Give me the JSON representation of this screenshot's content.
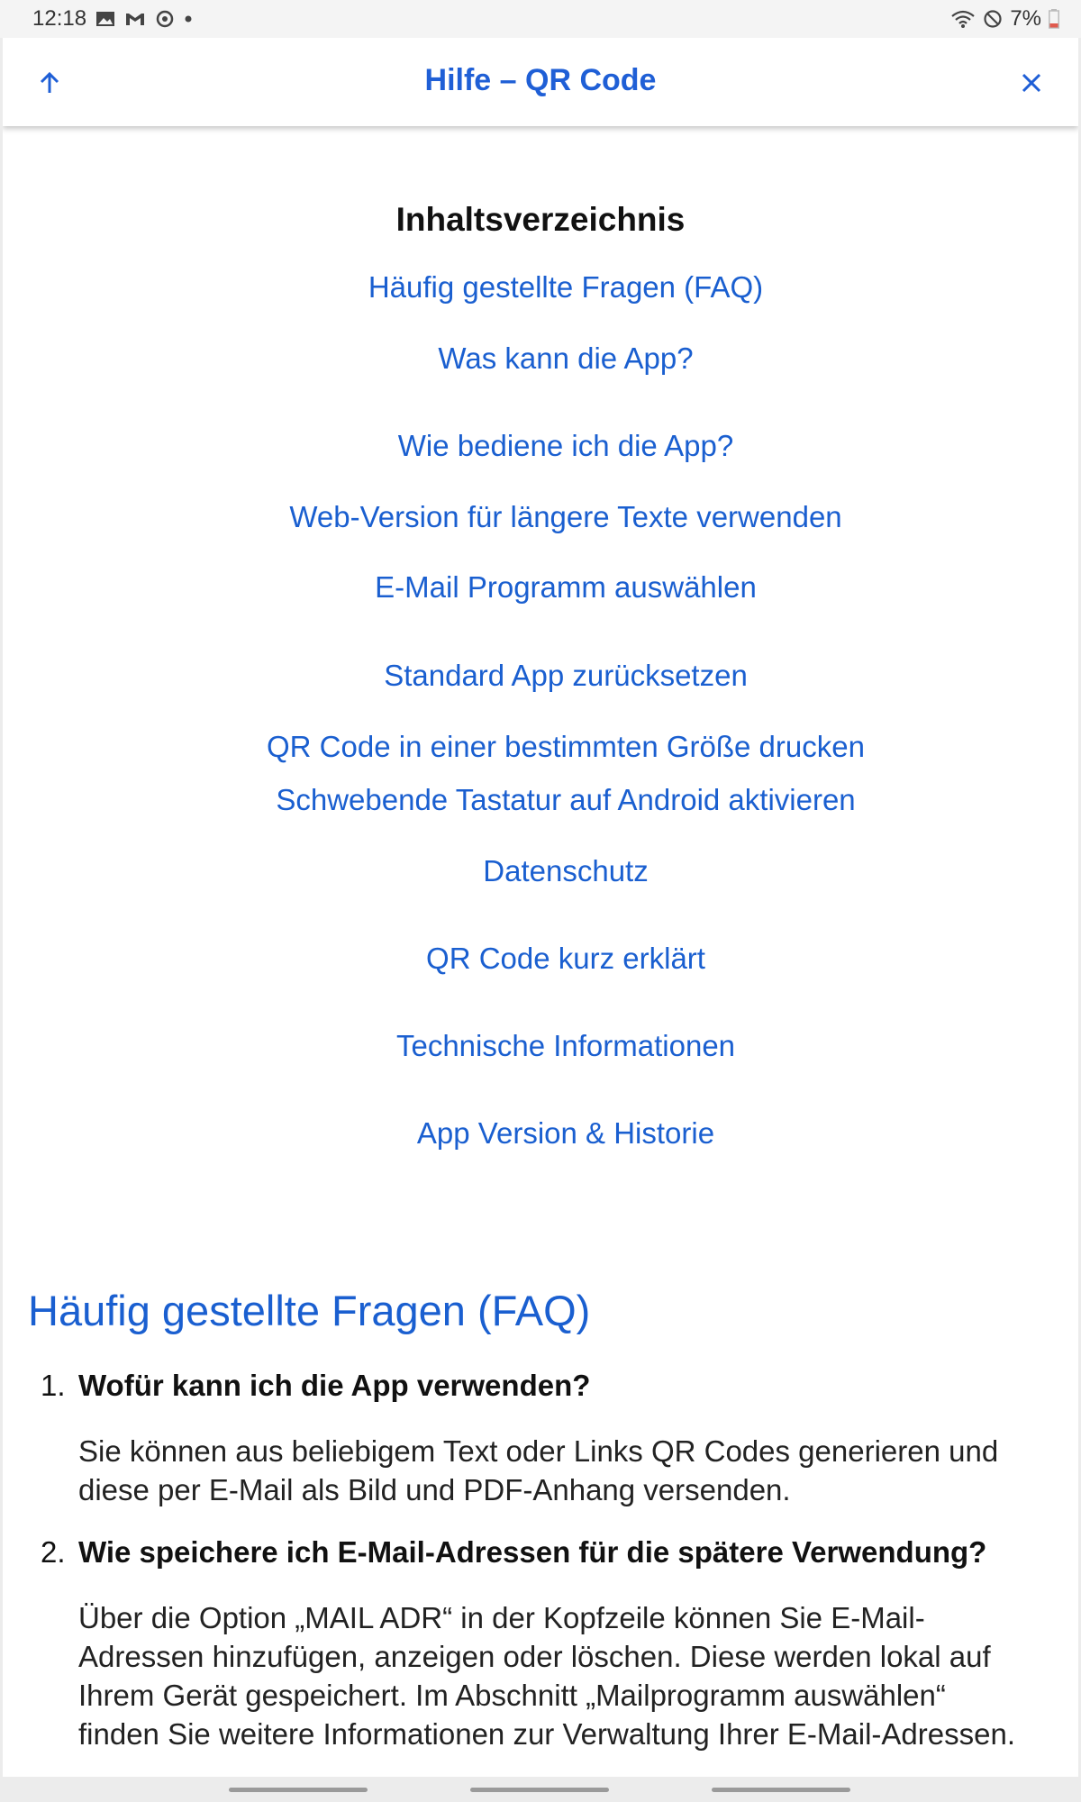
{
  "status_bar": {
    "time": "12:18",
    "notification_icons": [
      "image-icon",
      "gmail-icon",
      "sync-icon",
      "dot-icon"
    ],
    "battery": "7%"
  },
  "header": {
    "title": "Hilfe – QR Code",
    "up_icon": "arrow-up-icon",
    "close_icon": "close-icon",
    "accent_color": "#1f5fd6"
  },
  "toc": {
    "heading": "Inhaltsverzeichnis",
    "items": [
      "Häufig gestellte Fragen (FAQ)",
      "Was kann die App?",
      "Wie bediene ich die App?",
      "Web-Version für längere Texte verwenden",
      "E-Mail Programm auswählen",
      "Standard App zurücksetzen",
      "QR Code in einer bestimmten Größe drucken",
      "Schwebende Tastatur auf Android aktivieren",
      "Datenschutz",
      "QR Code kurz erklärt",
      "Technische Informationen",
      "App Version & Historie"
    ]
  },
  "faq": {
    "heading": "Häufig gestellte Fragen (FAQ)",
    "items": [
      {
        "number": "1.",
        "question": "Wofür kann ich die App verwenden?",
        "answer": "Sie können aus beliebigem Text oder Links QR Codes generieren und diese per E-Mail als Bild und PDF-Anhang versenden."
      },
      {
        "number": "2.",
        "question": "Wie speichere ich E-Mail-Adressen für die spätere Verwendung?",
        "answer": "Über die Option „MAIL ADR“ in der Kopfzeile können Sie E-Mail-Adressen hinzufügen, anzeigen oder löschen. Diese werden lokal auf Ihrem Gerät gespeichert. Im Abschnitt „Mailprogramm auswählen“ finden Sie weitere Informationen zur Verwaltung Ihrer E-Mail-Adressen."
      }
    ]
  }
}
